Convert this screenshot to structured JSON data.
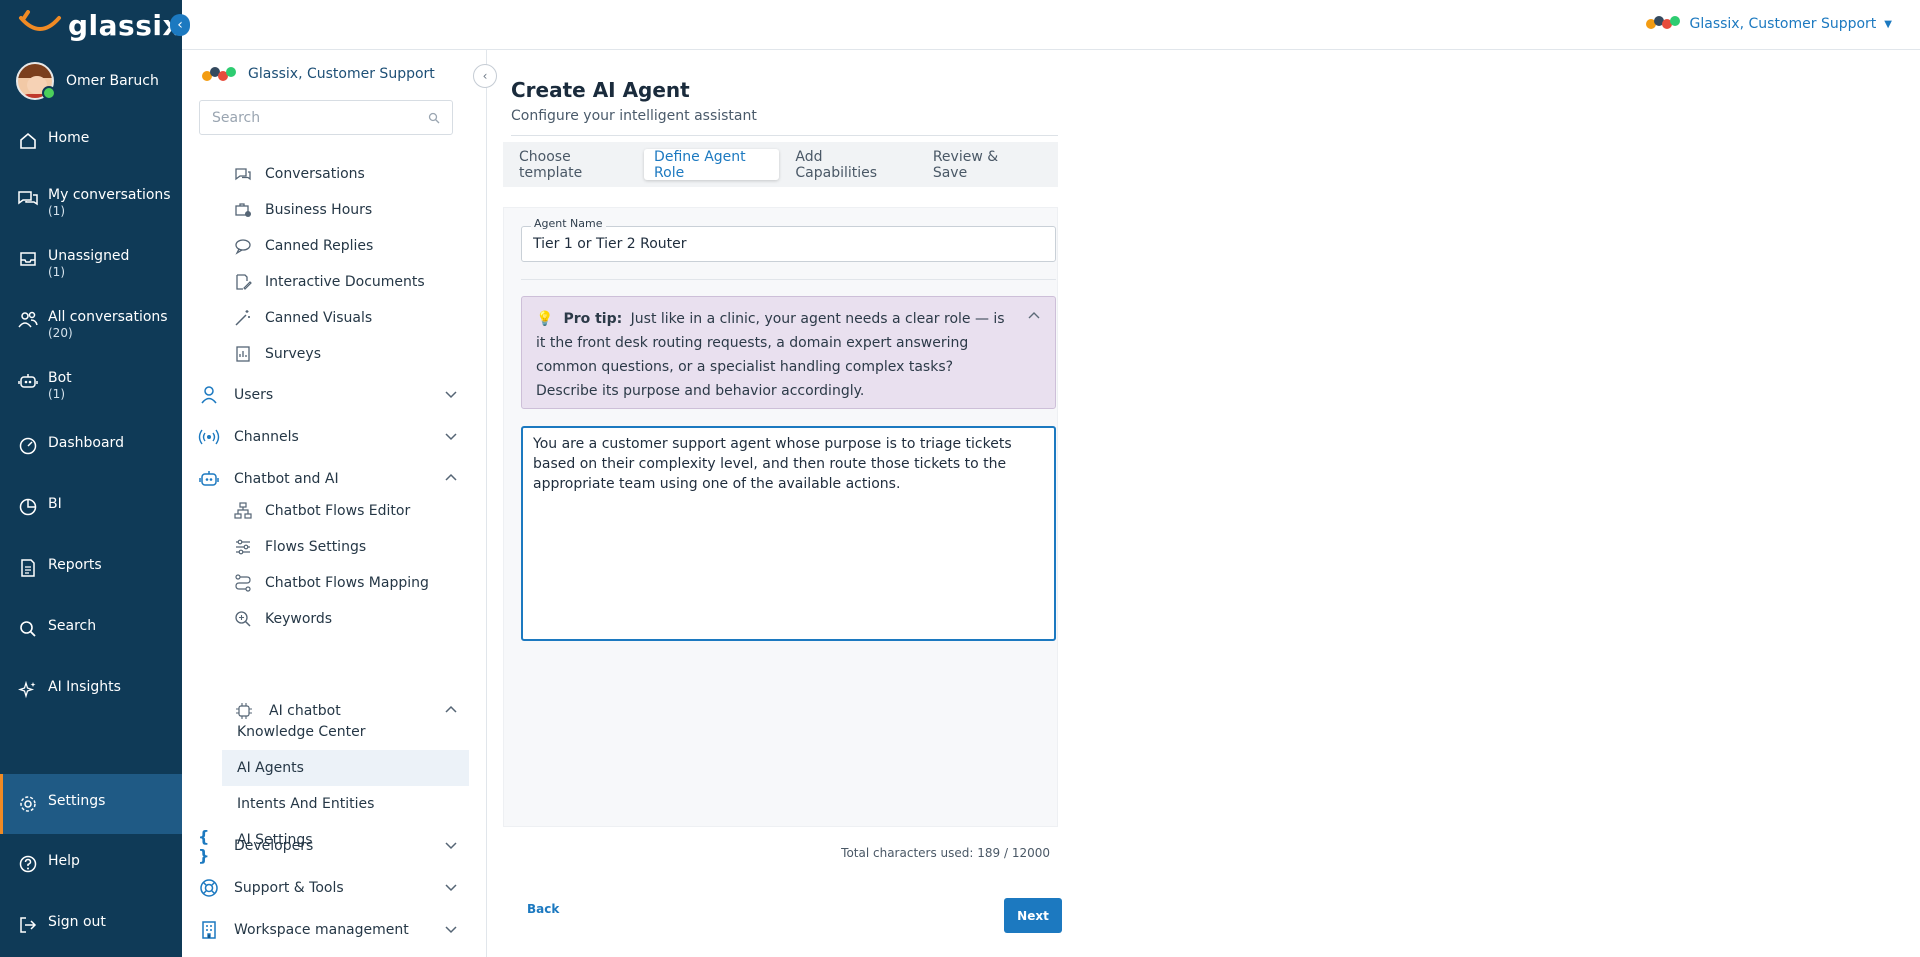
{
  "app": {
    "brand": "glassix"
  },
  "user": {
    "name": "Omer Baruch"
  },
  "leftnav": {
    "items": [
      {
        "label": "Home",
        "count": "",
        "icon": "home-icon"
      },
      {
        "label": "My conversations",
        "count": "(1)",
        "icon": "conversations-icon"
      },
      {
        "label": "Unassigned",
        "count": "(1)",
        "icon": "inbox-icon"
      },
      {
        "label": "All conversations",
        "count": "(20)",
        "icon": "team-icon"
      },
      {
        "label": "Bot",
        "count": "(1)",
        "icon": "bot-icon"
      },
      {
        "label": "Dashboard",
        "count": "",
        "icon": "dashboard-icon"
      },
      {
        "label": "BI",
        "count": "",
        "icon": "pie-chart-icon"
      },
      {
        "label": "Reports",
        "count": "",
        "icon": "report-icon"
      },
      {
        "label": "Search",
        "count": "",
        "icon": "search-icon"
      },
      {
        "label": "AI Insights",
        "count": "",
        "icon": "sparkle-icon"
      },
      {
        "label": "Settings",
        "count": "",
        "icon": "gear-icon"
      },
      {
        "label": "Help",
        "count": "",
        "icon": "help-icon"
      },
      {
        "label": "Sign out",
        "count": "",
        "icon": "sign-out-icon"
      }
    ],
    "active": "Settings"
  },
  "topbar": {
    "workspace": "Glassix, Customer Support"
  },
  "subnav": {
    "org": "Glassix, Customer Support",
    "search_placeholder": "Search",
    "items": [
      {
        "label": "Conversations",
        "icon": "chat-icon"
      },
      {
        "label": "Business Hours",
        "icon": "briefcase-clock-icon"
      },
      {
        "label": "Canned Replies",
        "icon": "reply-icon"
      },
      {
        "label": "Interactive Documents",
        "icon": "document-edit-icon"
      },
      {
        "label": "Canned Visuals",
        "icon": "magic-wand-icon"
      },
      {
        "label": "Surveys",
        "icon": "survey-icon"
      }
    ],
    "groups": {
      "users": "Users",
      "channels": "Channels",
      "chatbot": "Chatbot and AI",
      "developers": "Developers",
      "support": "Support & Tools",
      "workspace": "Workspace management"
    },
    "chatbot_items": [
      {
        "label": "Chatbot Flows Editor",
        "icon": "flow-icon"
      },
      {
        "label": "Flows Settings",
        "icon": "sliders-icon"
      },
      {
        "label": "Chatbot Flows Mapping",
        "icon": "route-icon"
      },
      {
        "label": "Keywords",
        "icon": "keyword-search-icon"
      },
      {
        "label": "AI chatbot",
        "icon": "chip-icon"
      }
    ],
    "ai_items": [
      "Knowledge Center",
      "AI Agents",
      "Intents And Entities",
      "AI Settings"
    ],
    "selected": "AI Agents"
  },
  "wizard": {
    "title": "Create AI Agent",
    "subtitle": "Configure your intelligent assistant",
    "steps": [
      "Choose template",
      "Define Agent Role",
      "Add Capabilities",
      "Review & Save"
    ],
    "active_step": "Define Agent Role",
    "agent_name_label": "Agent Name",
    "agent_name_value": "Tier 1 or Tier 2 Router",
    "tip_label": "Pro tip:",
    "tip_text": "Just like in a clinic, your agent needs a clear role — is it the front desk routing requests, a domain expert answering common questions, or a specialist handling complex tasks? Describe its purpose and behavior accordingly.",
    "prompt_value": "You are a customer support agent whose purpose is to triage tickets based on their complexity level, and then route those tickets to the appropriate team using one of the available actions.",
    "char_count": "Total characters used: 189 / 12000",
    "back_label": "Back",
    "next_label": "Next"
  },
  "colors": {
    "nav_bg": "#0f3a57",
    "accent": "#1c79c0",
    "active_marker": "#f08a24",
    "tip_bg": "#e9e0ef"
  }
}
